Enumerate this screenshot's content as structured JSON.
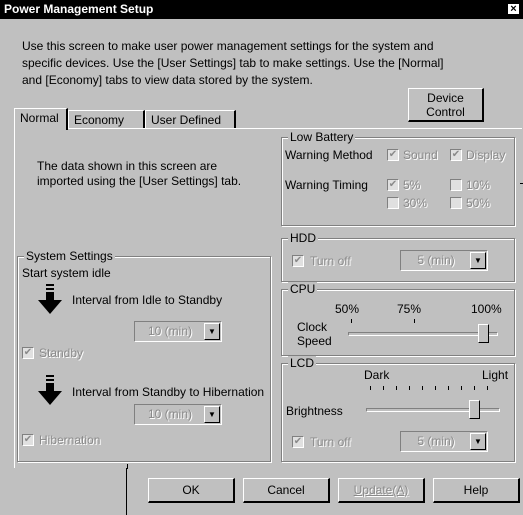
{
  "window": {
    "title": "Power Management Setup",
    "close_glyph": "×"
  },
  "intro": {
    "line1": "Use this screen to make user power management settings for the system and",
    "line2": "specific devices. Use the [User Settings] tab to make settings. Use the [Normal]",
    "line3": "and [Economy] tabs to view data stored by the system."
  },
  "device_control": {
    "line1": "Device",
    "line2": "Control"
  },
  "tabs": [
    {
      "label": "Normal",
      "selected": true
    },
    {
      "label": "Economy"
    },
    {
      "label": "User Defined"
    }
  ],
  "info_text": {
    "line1": "The data shown in this screen are",
    "line2": "imported using the [User Settings] tab."
  },
  "system_settings": {
    "title": "System Settings",
    "start_idle": "Start system idle",
    "idle_to_standby": "Interval from Idle to Standby",
    "standby_interval": "10 (min)",
    "standby_label": "Standby",
    "standby_checked": true,
    "standby_to_hibernation": "Interval from Standby to Hibernation",
    "hibernation_interval": "10 (min)",
    "hibernation_label": "Hibernation",
    "hibernation_checked": true
  },
  "low_battery": {
    "title": "Low Battery",
    "warning_method_label": "Warning Method",
    "sound_label": "Sound",
    "sound_checked": true,
    "display_label": "Display",
    "display_checked": true,
    "warning_timing_label": "Warning Timing",
    "timing_options": [
      {
        "label": "5%",
        "checked": true
      },
      {
        "label": "10%",
        "checked": false
      },
      {
        "label": "30%",
        "checked": false
      },
      {
        "label": "50%",
        "checked": false
      }
    ]
  },
  "hdd": {
    "title": "HDD",
    "turn_off_label": "Turn off",
    "turn_off_checked": true,
    "interval": "5 (min)"
  },
  "cpu": {
    "title": "CPU",
    "label_line1": "Clock",
    "label_line2": "Speed",
    "ticks": [
      "50%",
      "75%",
      "100%"
    ],
    "value": "100%"
  },
  "lcd": {
    "title": "LCD",
    "dark_label": "Dark",
    "light_label": "Light",
    "brightness_label": "Brightness",
    "brightness_level_fraction": 0.85,
    "turn_off_label": "Turn off",
    "turn_off_checked": true,
    "interval": "5 (min)"
  },
  "buttons": {
    "ok": "OK",
    "cancel": "Cancel",
    "update": "Update(A)",
    "help": "Help"
  },
  "icons": {
    "checkmark": "✔",
    "dropdown": "▼"
  }
}
